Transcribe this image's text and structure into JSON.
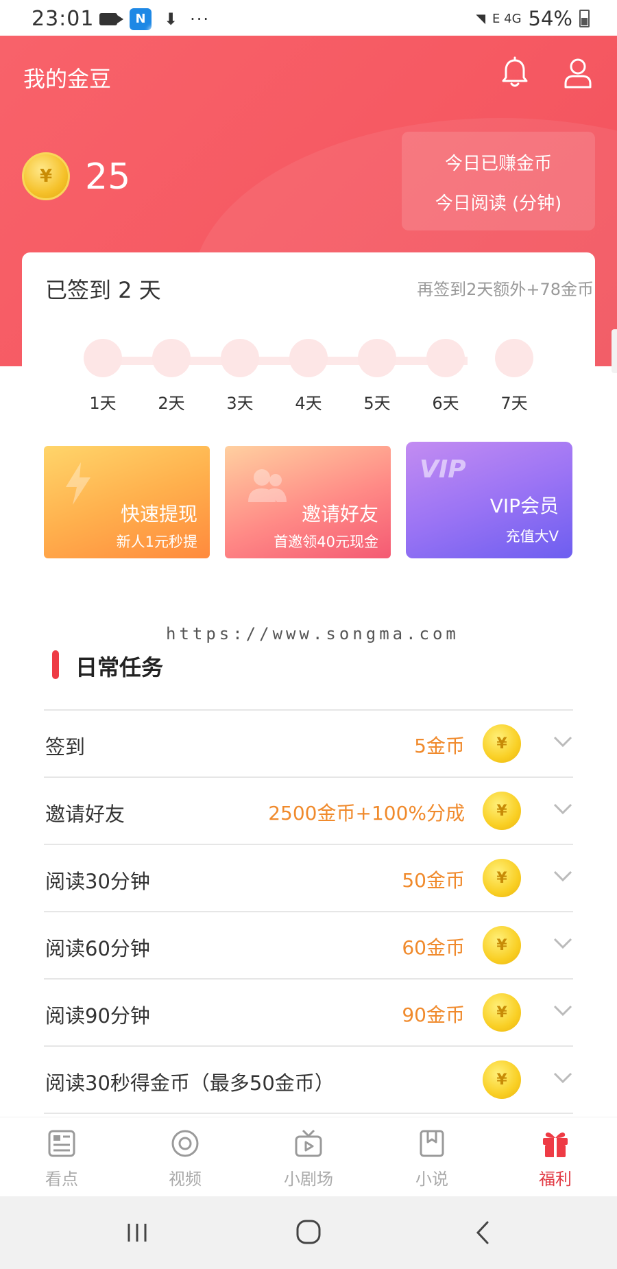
{
  "status_bar": {
    "time": "23:01",
    "signal_text": "E  4G",
    "battery": "54%",
    "more": "···"
  },
  "header": {
    "title": "我的金豆",
    "coin_symbol": "¥",
    "coin_count": "25",
    "today_earned_label": "今日已赚金币",
    "today_read_label": "今日阅读 (分钟)"
  },
  "sign_in": {
    "signed_text": "已签到 2 天",
    "extra_text": "再签到2天额外+78金币",
    "days": [
      "1天",
      "2天",
      "3天",
      "4天",
      "5天",
      "6天",
      "7天"
    ]
  },
  "promos": [
    {
      "title": "快速提现",
      "subtitle": "新人1元秒提"
    },
    {
      "title": "邀请好友",
      "subtitle": "首邀领40元现金"
    },
    {
      "title": "VIP会员",
      "subtitle": "充值大V",
      "mark": "VIP"
    }
  ],
  "watermark": "https://www.songma.com",
  "daily_tasks": {
    "title": "日常任务",
    "items": [
      {
        "name": "签到",
        "reward": "5金币"
      },
      {
        "name": "邀请好友",
        "reward": "2500金币+100%分成"
      },
      {
        "name": "阅读30分钟",
        "reward": "50金币"
      },
      {
        "name": "阅读60分钟",
        "reward": "60金币"
      },
      {
        "name": "阅读90分钟",
        "reward": "90金币"
      },
      {
        "name": "阅读30秒得金币（最多50金币）",
        "reward": ""
      }
    ]
  },
  "bottom_nav": {
    "items": [
      {
        "label": "看点",
        "icon": "news-icon"
      },
      {
        "label": "视频",
        "icon": "video-icon"
      },
      {
        "label": "小剧场",
        "icon": "tv-icon"
      },
      {
        "label": "小说",
        "icon": "book-icon"
      },
      {
        "label": "福利",
        "icon": "gift-icon"
      }
    ],
    "active": "福利"
  },
  "colors": {
    "header": "#f65a63",
    "accent": "#e23b45",
    "reward": "#f08a2c",
    "coin": "#f9cf24"
  }
}
